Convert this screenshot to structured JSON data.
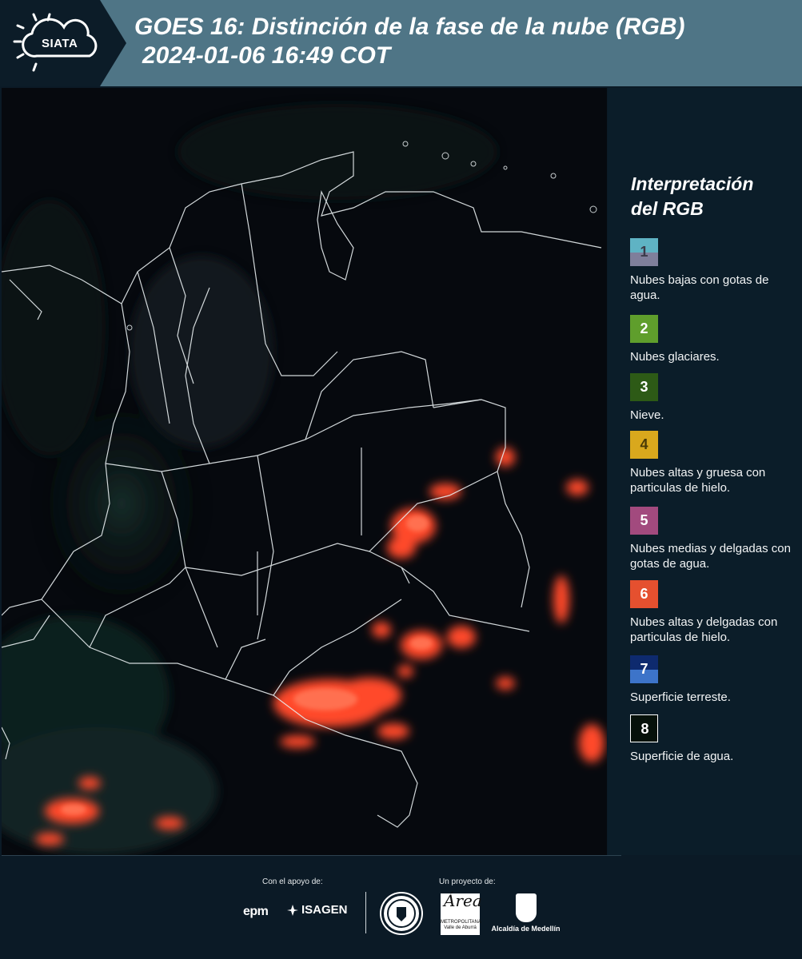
{
  "header": {
    "logo_text": "SIATA",
    "title_line1": "GOES 16: Distinción de la fase de la nube (RGB)",
    "title_line2": "2024-01-06 16:49 COT"
  },
  "legend": {
    "title_line1": "Interpretación",
    "title_line2": "del RGB",
    "items": [
      {
        "number": "1",
        "label": "Nubes bajas con gotas de agua.",
        "color_top": "#5fb3c4",
        "color_bottom": "#7f7f9b",
        "num_color": "#3b3b4a"
      },
      {
        "number": "2",
        "label": "Nubes glaciares.",
        "color": "#5f9e2c",
        "num_color": "#ffffff"
      },
      {
        "number": "3",
        "label": "Nieve.",
        "color": "#2d5a16",
        "num_color": "#ffffff"
      },
      {
        "number": "4",
        "label": "Nubes altas y gruesa con particulas de hielo.",
        "color": "#d9a81d",
        "num_color": "#4a3a06"
      },
      {
        "number": "5",
        "label": "Nubes medias y delgadas con gotas de agua.",
        "color": "#a24a7e",
        "num_color": "#ffffff"
      },
      {
        "number": "6",
        "label": "Nubes altas y delgadas con particulas de hielo.",
        "color": "#e5502f",
        "num_color": "#ffffff"
      },
      {
        "number": "7",
        "label": "Superficie terreste.",
        "color_top": "#0e2a6e",
        "color_bottom": "#3d74c9",
        "num_color": "#ffffff"
      },
      {
        "number": "8",
        "label": "Superficie de agua.",
        "color": "#06110a",
        "num_color": "#ffffff",
        "border": "#ffffff"
      }
    ]
  },
  "footer": {
    "support_label": "Con el apoyo de:",
    "project_label": "Un proyecto de:",
    "epm": "epm",
    "isagen": "ISAGEN",
    "metro_script": "Área",
    "metro_text": "METROPOLITANA Valle de Aburrá",
    "medellin": "Alcaldía de Medellín"
  }
}
